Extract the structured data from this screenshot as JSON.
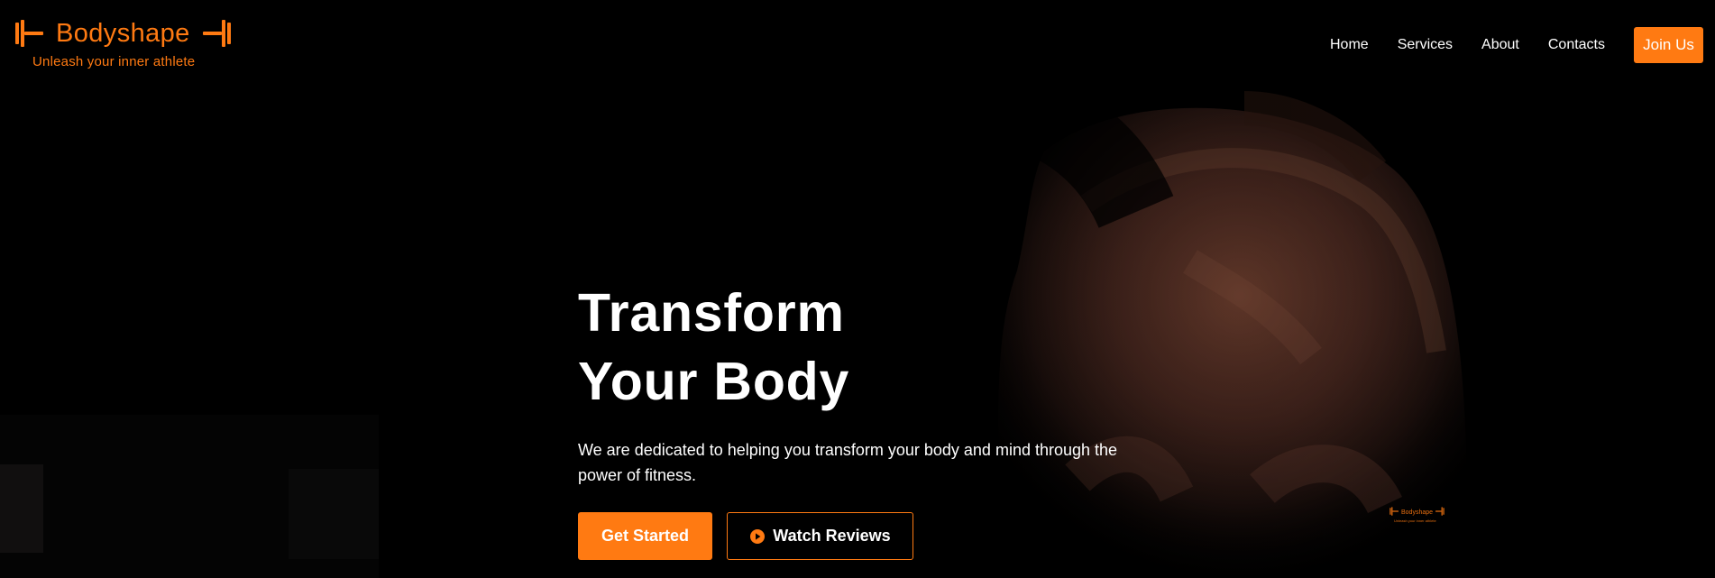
{
  "brand": {
    "name": "Bodyshape",
    "tagline": "Unleash your inner athlete",
    "icon_left": "dumbbell-left-icon",
    "icon_right": "dumbbell-right-icon",
    "accent": "#ff7a12"
  },
  "nav": {
    "items": [
      {
        "label": "Home"
      },
      {
        "label": "Services"
      },
      {
        "label": "About"
      },
      {
        "label": "Contacts"
      }
    ],
    "join_label": "Join Us"
  },
  "hero": {
    "title_line_1": "Transform",
    "title_line_2": "Your Body",
    "description": "We are dedicated to helping you transform your body and mind through the power of fitness.",
    "primary_button": "Get Started",
    "secondary_button": "Watch Reviews",
    "secondary_icon": "play-circle-icon"
  },
  "watermark": {
    "name": "Bodyshape",
    "tagline": "Unleash your inner athlete"
  },
  "colors": {
    "background": "#000000",
    "text": "#ffffff",
    "accent": "#ff7a12"
  }
}
